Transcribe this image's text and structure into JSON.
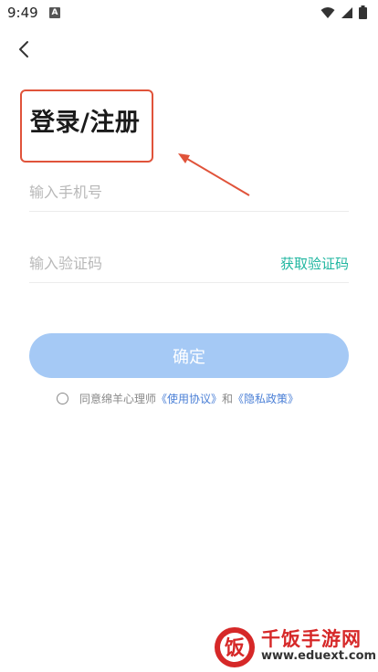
{
  "status_bar": {
    "time": "9:49",
    "notification_badge": "A"
  },
  "header": {
    "title": "登录/注册"
  },
  "form": {
    "phone_placeholder": "输入手机号",
    "code_placeholder": "输入验证码",
    "get_code_label": "获取验证码"
  },
  "confirm_label": "确定",
  "agreement": {
    "prefix": "同意绵羊心理师",
    "terms_link": "《使用协议》",
    "conjunction": "和",
    "privacy_link": "《隐私政策》",
    "checked": false
  },
  "watermark": {
    "logo_glyph": "饭",
    "site_name": "千饭手游网",
    "url": "www.eduext.com"
  },
  "colors": {
    "annotation": "#e0533a",
    "accent_teal": "#1fb6a0",
    "button_disabled": "#a5c9f5",
    "link_blue": "#4a7fd6",
    "watermark_red": "#d62828"
  }
}
